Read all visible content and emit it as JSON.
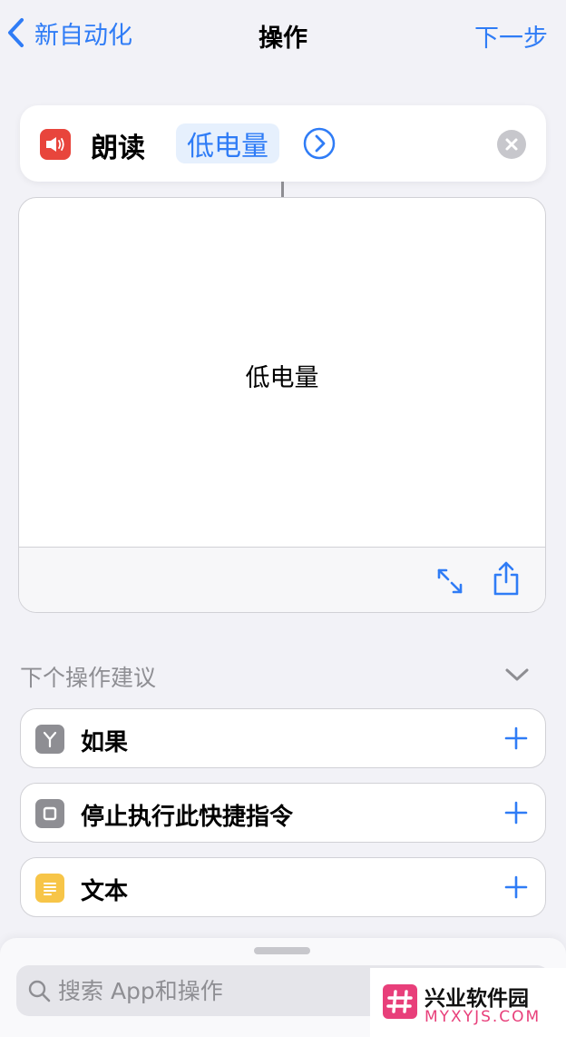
{
  "nav": {
    "back_label": "新自动化",
    "title": "操作",
    "next_label": "下一步"
  },
  "action": {
    "name": "朗读",
    "parameter": "低电量",
    "icon": "speaker-icon",
    "icon_color": "#e8453c"
  },
  "preview": {
    "text": "低电量"
  },
  "suggestions": {
    "header": "下个操作建议",
    "items": [
      {
        "label": "如果",
        "icon": "branch-icon",
        "icon_color": "#8e8e93"
      },
      {
        "label": "停止执行此快捷指令",
        "icon": "stop-icon",
        "icon_color": "#8e8e93"
      },
      {
        "label": "文本",
        "icon": "text-icon",
        "icon_color": "#f7c548"
      }
    ]
  },
  "search": {
    "placeholder": "搜索 App和操作"
  },
  "watermark": {
    "title": "兴业软件园",
    "subtitle": "MYXYJS.COM"
  },
  "colors": {
    "accent": "#2f7cf6",
    "background": "#f2f2f7"
  }
}
